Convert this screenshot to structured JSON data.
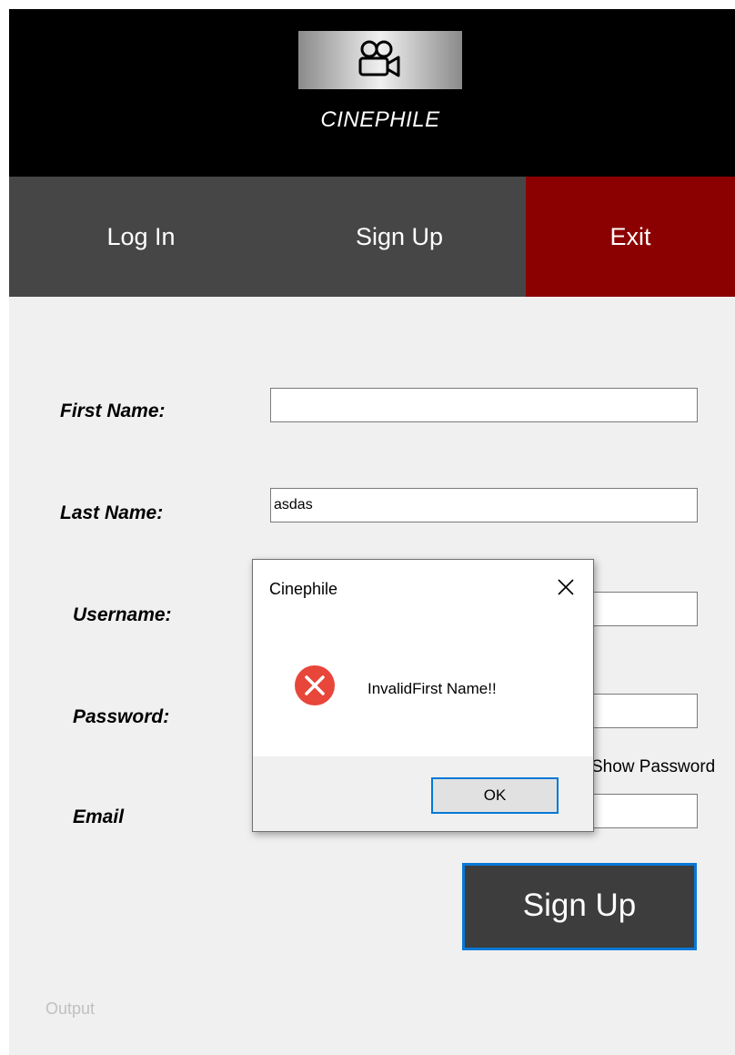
{
  "brand": {
    "name": "CINEPHILE",
    "logo_icon": "movie-camera-icon"
  },
  "nav": {
    "login": "Log In",
    "signup": "Sign Up",
    "exit": "Exit",
    "exit_color": "#8b0000"
  },
  "form": {
    "first_name_label": "First Name:",
    "first_name_value": "",
    "last_name_label": "Last Name:",
    "last_name_value": "asdas",
    "username_label": "Username:",
    "username_value": "",
    "password_label": "Password:",
    "password_value": "",
    "show_password_label": "Show Password",
    "email_label": "Email",
    "email_value": "",
    "submit_label": "Sign Up"
  },
  "output_label": "Output",
  "dialog": {
    "title": "Cinephile",
    "message": "InvalidFirst Name!!",
    "ok_label": "OK",
    "icon": "error-icon",
    "close_icon": "close-icon"
  },
  "colors": {
    "header_bg": "#000000",
    "nav_bg": "#464646",
    "accent": "#0a78d7",
    "error": "#e8463a"
  }
}
